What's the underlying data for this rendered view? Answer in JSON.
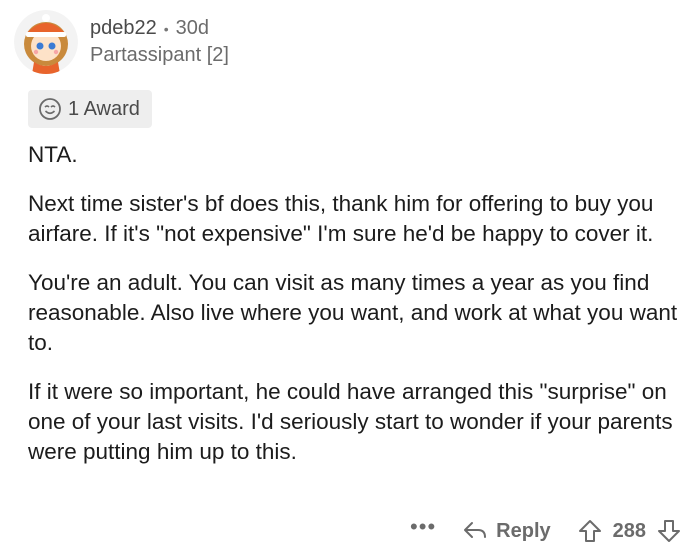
{
  "comment": {
    "author": "pdeb22",
    "age": "30d",
    "flair": "Partassipant [2]",
    "award_label": "1 Award",
    "paragraphs": [
      "NTA.",
      "Next time sister's bf does this, thank him for offering to buy you airfare. If it's \"not expensive\" I'm sure he'd be happy to cover it.",
      "You're an adult. You can visit as many times a year as you find reasonable. Also live where you want, and work at what you want to.",
      "If it were so important, he could have arranged this \"surprise\" on one of your last visits. I'd seriously start to wonder if your parents were putting him up to this."
    ],
    "actions": {
      "more_label": "•••",
      "reply_label": "Reply",
      "score": "288"
    }
  },
  "icons": [
    "avatar",
    "award-icon",
    "more-options-icon",
    "reply-arrow-icon",
    "upvote-icon",
    "downvote-icon"
  ],
  "colors": {
    "text": "#1c1c1c",
    "muted": "#6b6b6b",
    "award_bg": "#eeeeee"
  }
}
